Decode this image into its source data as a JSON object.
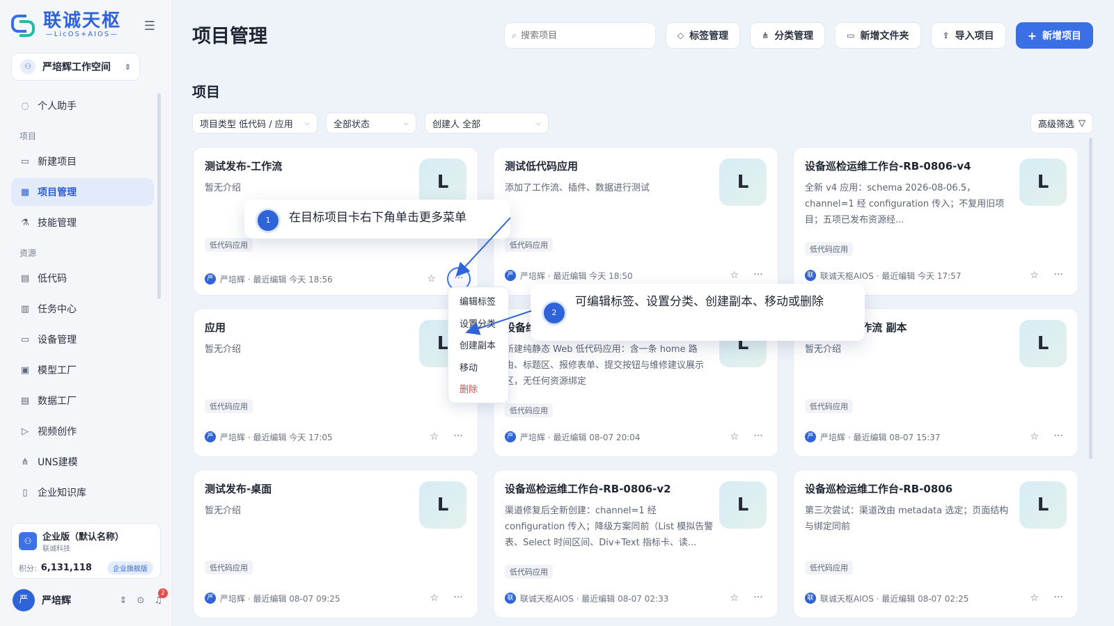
{
  "brand": {
    "name": "联诚天枢",
    "sub": "—LicOS+AIOS—"
  },
  "workspace": {
    "name": "严培辉工作空间"
  },
  "nav": {
    "assistant": "个人助手",
    "section_project": "项目",
    "new_project": "新建项目",
    "project_manage": "项目管理",
    "skill_manage": "技能管理",
    "section_resource": "资源",
    "lowcode": "低代码",
    "task_center": "任务中心",
    "device_manage": "设备管理",
    "model_factory": "模型工厂",
    "data_factory": "数据工厂",
    "video_create": "视频创作",
    "uns_model": "UNS建模",
    "knowledge": "企业知识库"
  },
  "enterprise": {
    "name": "企业版（默认名称）",
    "company": "联诚科技",
    "points_label": "积分:",
    "points": "6,131,118",
    "badge": "企业旗舰版"
  },
  "user": {
    "name": "严培辉",
    "avatar": "严",
    "notifications": "2"
  },
  "header": {
    "title": "项目管理",
    "search_placeholder": "搜索项目",
    "tag_manage": "标签管理",
    "category_manage": "分类管理",
    "new_folder": "新增文件夹",
    "import_project": "导入项目",
    "new_project": "新增项目"
  },
  "section": {
    "title": "项目"
  },
  "filters": {
    "type": "项目类型 低代码 / 应用",
    "status": "全部状态",
    "creator": "创建人 全部",
    "advanced": "高级筛选"
  },
  "cards": [
    {
      "title": "测试发布-工作流",
      "desc": "暂无介绍",
      "tile": "L",
      "tag": "低代码应用",
      "avatar": "严",
      "meta": "严培辉 · 最近编辑 今天 18:56"
    },
    {
      "title": "测试低代码应用",
      "desc": "添加了工作流、插件、数据进行测试",
      "tile": "L",
      "tag": "低代码应用",
      "avatar": "严",
      "meta": "严培辉 · 最近编辑 今天 18:50"
    },
    {
      "title": "设备巡检运维工作台-RB-0806-v4",
      "desc": "全新 v4 应用：schema 2026-08-06.5，channel=1 经 configuration 传入；不复用旧项目；五项已发布资源经...",
      "tile": "L",
      "tag": "低代码应用",
      "avatar": "联",
      "meta": "联诚天枢AIOS · 最近编辑 今天 17:57"
    },
    {
      "title": "应用",
      "desc": "暂无介绍",
      "tile": "L",
      "tag": "低代码应用",
      "avatar": "严",
      "meta": "严培辉 · 最近编辑 今天 17:05"
    },
    {
      "title": "设备维修",
      "desc": "新建纯静态 Web 低代码应用：含一条 home 路由、标题区、报修表单、提交按钮与维修建议展示区，无任何资源绑定",
      "tile": "L",
      "tag": "低代码应用",
      "avatar": "严",
      "meta": "严培辉 · 最近编辑 08-07 20:04"
    },
    {
      "title": "测试发布-工作流 副本",
      "desc": "暂无介绍",
      "tile": "L",
      "tag": "低代码应用",
      "avatar": "严",
      "meta": "严培辉 · 最近编辑 08-07 15:37"
    },
    {
      "title": "测试发布-桌面",
      "desc": "暂无介绍",
      "tile": "L",
      "tag": "低代码应用",
      "avatar": "严",
      "meta": "严培辉 · 最近编辑 08-07 09:25"
    },
    {
      "title": "设备巡检运维工作台-RB-0806-v2",
      "desc": "渠道修复后全新创建：channel=1 经 configuration 传入；降级方案同前（List 模拟告警表、Select 时间区间、Div+Text 指标卡、读...",
      "tile": "L",
      "tag": "低代码应用",
      "avatar": "联",
      "meta": "联诚天枢AIOS · 最近编辑 08-07 02:33"
    },
    {
      "title": "设备巡检运维工作台-RB-0806",
      "desc": "第三次尝试：渠道改由 metadata 选定；页面结构与绑定同前",
      "tile": "L",
      "tag": "低代码应用",
      "avatar": "联",
      "meta": "联诚天枢AIOS · 最近编辑 08-07 02:25"
    }
  ],
  "menu": {
    "edit_tags": "编辑标签",
    "set_category": "设置分类",
    "duplicate": "创建副本",
    "move": "移动",
    "delete": "删除"
  },
  "callouts": {
    "step1": "1",
    "text1": "在目标项目卡右下角单击更多菜单",
    "step2": "2",
    "text2": "可编辑标签、设置分类、创建副本、移动或删除"
  },
  "colors": {
    "primary": "#3b6fe6",
    "danger": "#e04b4b"
  }
}
